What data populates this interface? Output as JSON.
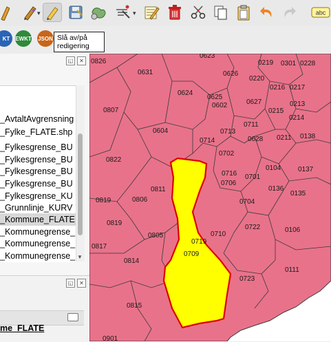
{
  "toolbar": {
    "icons": [
      "digitize-pencil-icon",
      "toggle-editing-pencil-icon",
      "save-edits-icon",
      "add-polygon-icon",
      "vertex-tool-icon",
      "modify-attributes-icon",
      "delete-selected-icon",
      "cut-features-icon",
      "copy-features-icon",
      "paste-features-icon",
      "undo-icon",
      "redo-icon",
      "label-abc-icon"
    ],
    "abc_label": "abc"
  },
  "second_toolbar": {
    "wkt_label": "KT",
    "ewkt_label": "EWKT",
    "json_label": "JSON",
    "colors": {
      "wkt": "#2a64b4",
      "ewkt": "#2f8a3a",
      "json": "#c8651a"
    }
  },
  "tooltip": {
    "text": "Slå av/på redigering"
  },
  "layers_panel": {
    "items": [
      {
        "label": "_AvtaltAvgrensning",
        "selected": false
      },
      {
        "label": "_Fylke_FLATE.shp",
        "selected": false
      },
      {
        "label": "_Fylkesgrense_BU",
        "selected": false
      },
      {
        "label": "_Fylkesgrense_BU",
        "selected": false
      },
      {
        "label": "_Fylkesgrense_BU",
        "selected": false
      },
      {
        "label": "_Fylkesgrense_BU",
        "selected": false
      },
      {
        "label": "_Fylkesgrense_KU",
        "selected": false
      },
      {
        "label": "_Grunnlinje_KURV",
        "selected": false
      },
      {
        "label": "_Kommune_FLATE",
        "selected": true
      },
      {
        "label": "_Kommunegrense_",
        "selected": false
      },
      {
        "label": "_Kommunegrense_",
        "selected": false
      },
      {
        "label": "_Kommunegrense_",
        "selected": false
      }
    ]
  },
  "bottom_panel": {
    "layer_name": "me_FLATE"
  },
  "map": {
    "colors": {
      "polygon_fill": "#e8728a",
      "selected_fill": "#ffff00",
      "selected_border": "#e00000",
      "boundary": "#3a3a3a"
    },
    "labels": [
      "0826",
      "0623",
      "0219",
      "0301",
      "0228",
      "0631",
      "0626",
      "0220",
      "0216",
      "0217",
      "0624",
      "0625",
      "0602",
      "0627",
      "0213",
      "0807",
      "0215",
      "0214",
      "0711",
      "0604",
      "0713",
      "0628",
      "0211",
      "0138",
      "0714",
      "0702",
      "0822",
      "0716",
      "0104",
      "0137",
      "0811",
      "0701",
      "0136",
      "0706",
      "0135",
      "0819",
      "0806",
      "0704",
      "0819",
      "0722",
      "0106",
      "0805",
      "0710",
      "0817",
      "0719",
      "0709",
      "0814",
      "0723",
      "0111",
      "0815",
      "0901",
      "0212",
      "0221"
    ]
  }
}
